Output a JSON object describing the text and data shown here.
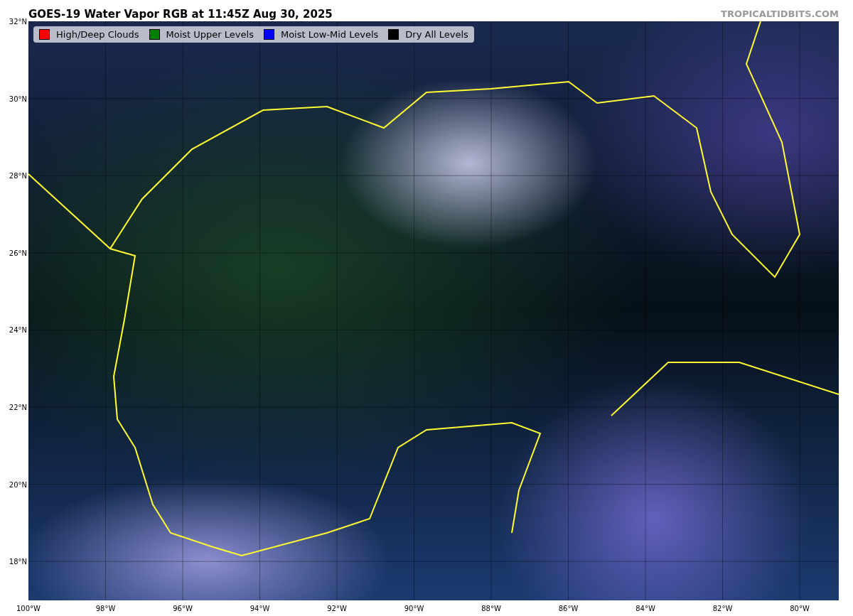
{
  "title": "GOES-19 Water Vapor RGB at 11:45Z Aug 30, 2025",
  "credit": "TROPICALTIDBITS.COM",
  "legend": [
    {
      "label": "High/Deep Clouds",
      "color": "#ff0000"
    },
    {
      "label": "Moist Upper Levels",
      "color": "#008000"
    },
    {
      "label": "Moist Low-Mid Levels",
      "color": "#0000ff"
    },
    {
      "label": "Dry All Levels",
      "color": "#000000"
    }
  ],
  "map": {
    "lat_labels": [
      "32°N",
      "30°N",
      "28°N",
      "26°N",
      "24°N",
      "22°N",
      "20°N",
      "18°N"
    ],
    "lon_labels": [
      "100°W",
      "98°W",
      "96°W",
      "94°W",
      "92°W",
      "90°W",
      "88°W",
      "86°W",
      "84°W",
      "82°W",
      "80°W"
    ]
  }
}
